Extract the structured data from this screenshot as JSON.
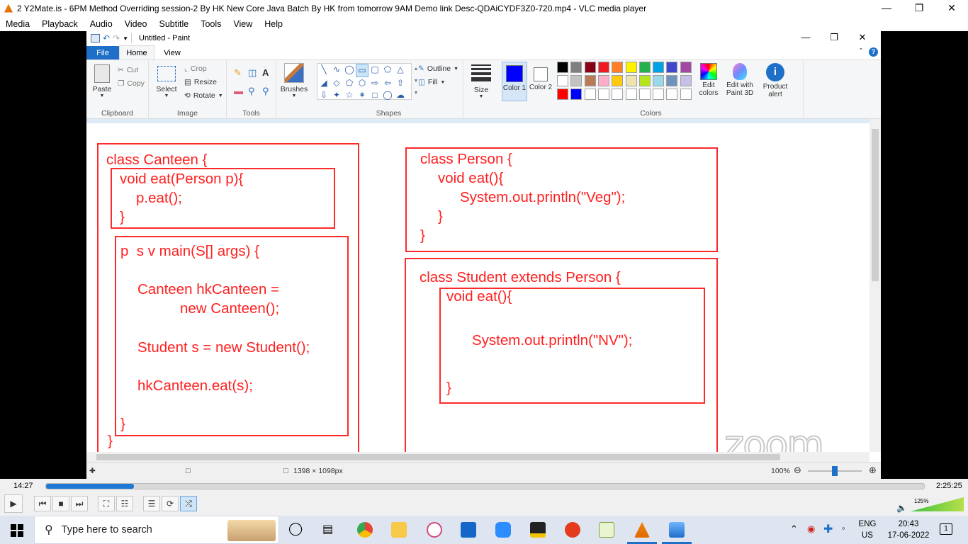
{
  "vlc": {
    "title": "2 Y2Mate.is - 6PM Method Overriding session-2 By HK New Core Java Batch By HK from tomorrow 9AM  Demo link Desc-QDAiCYDF3Z0-720.mp4 - VLC media player",
    "menu": [
      "Media",
      "Playback",
      "Audio",
      "Video",
      "Subtitle",
      "Tools",
      "View",
      "Help"
    ],
    "time_elapsed": "14:27",
    "time_total": "2:25:25",
    "progress": 0.1,
    "volume_label": "125%"
  },
  "paint": {
    "doc_title": "Untitled - Paint",
    "tabs": {
      "file": "File",
      "home": "Home",
      "view": "View"
    },
    "clipboard": {
      "paste": "Paste",
      "cut": "Cut",
      "copy": "Copy",
      "label": "Clipboard"
    },
    "image": {
      "select": "Select",
      "crop": "Crop",
      "resize": "Resize",
      "rotate": "Rotate",
      "label": "Image"
    },
    "tools_label": "Tools",
    "brushes": "Brushes",
    "shapes": {
      "outline": "Outline",
      "fill": "Fill",
      "label": "Shapes"
    },
    "size": "Size",
    "color1": "Color 1",
    "color2": "Color 2",
    "colors_label": "Colors",
    "edit_colors": "Edit colors",
    "edit_3d": "Edit with Paint 3D",
    "product_alert": "Product alert",
    "colors_row1": [
      "#000000",
      "#7f7f7f",
      "#880015",
      "#ed1c24",
      "#ff7f27",
      "#fff200",
      "#22b14c",
      "#00a2e8",
      "#3f48cc",
      "#a349a4"
    ],
    "colors_row2": [
      "#ffffff",
      "#c3c3c3",
      "#b97a57",
      "#ffaec9",
      "#ffc90e",
      "#efe4b0",
      "#b5e61d",
      "#99d9ea",
      "#7092be",
      "#c8bfe7"
    ],
    "colors_row3": [
      "#ff0000",
      "#0000ff",
      "#ffffff",
      "#ffffff",
      "#ffffff",
      "#ffffff",
      "#ffffff",
      "#ffffff",
      "#ffffff",
      "#ffffff"
    ],
    "primary_color": "#0000ff",
    "status_size": "1398 × 1098px",
    "zoom": "100%"
  },
  "code": {
    "canteen": [
      "class Canteen {",
      "void eat(Person p){",
      "p.eat();",
      "}"
    ],
    "main": [
      "p  s v main(S[] args) {",
      "Canteen hkCanteen =",
      "new Canteen();",
      "Student s = new Student();",
      "hkCanteen.eat(s);",
      "}",
      "}"
    ],
    "person": [
      "class Person {",
      "void eat(){",
      "System.out.println(\"Veg\");",
      "}",
      "}"
    ],
    "student": [
      "class Student extends Person {",
      "void eat(){",
      "System.out.println(\"NV\");",
      "}"
    ],
    "watermark": "zoom"
  },
  "taskbar": {
    "search_placeholder": "Type here to search",
    "lang_top": "ENG",
    "lang_bottom": "US",
    "clock_time": "20:43",
    "clock_date": "17-06-2022",
    "notif_count": "1"
  }
}
